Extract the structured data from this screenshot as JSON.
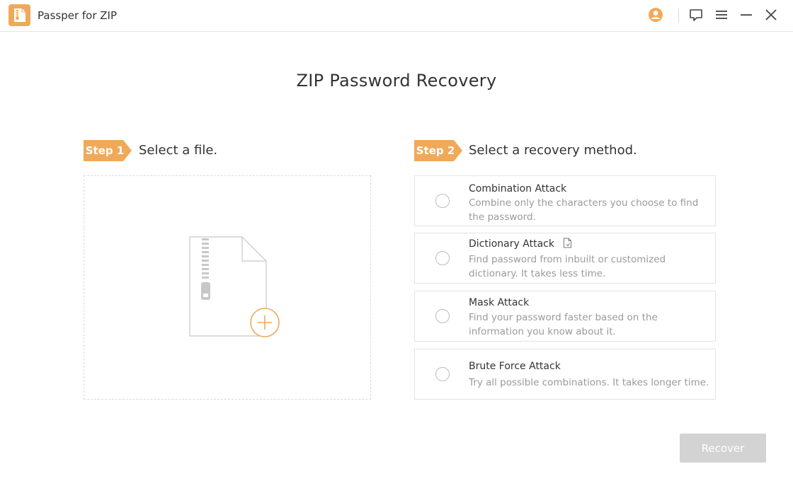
{
  "app": {
    "title": "Passper for ZIP"
  },
  "colors": {
    "accent": "#f0a959",
    "text": "#333333",
    "muted": "#9a9a9a",
    "border": "#e3e3e3",
    "disabled": "#d3d3d3"
  },
  "titlebar": {
    "icons": [
      "account-icon",
      "feedback-icon",
      "menu-icon",
      "minimize-icon",
      "close-icon"
    ]
  },
  "page": {
    "title": "ZIP Password Recovery"
  },
  "step1": {
    "tag": "Step 1",
    "label": "Select a file."
  },
  "step2": {
    "tag": "Step 2",
    "label": "Select a recovery method."
  },
  "methods": [
    {
      "title": "Combination Attack",
      "desc": "Combine only the characters you choose to find the password.",
      "selected": false
    },
    {
      "title": "Dictionary Attack",
      "desc": "Find password from inbuilt or customized dictionary. It takes less time.",
      "selected": false,
      "icon": "document-icon"
    },
    {
      "title": "Mask Attack",
      "desc": "Find your password faster based on the information you know about it.",
      "selected": false
    },
    {
      "title": "Brute Force Attack",
      "desc": "Try all possible combinations. It takes longer time.",
      "selected": false
    }
  ],
  "actions": {
    "recover_label": "Recover",
    "recover_enabled": false
  }
}
